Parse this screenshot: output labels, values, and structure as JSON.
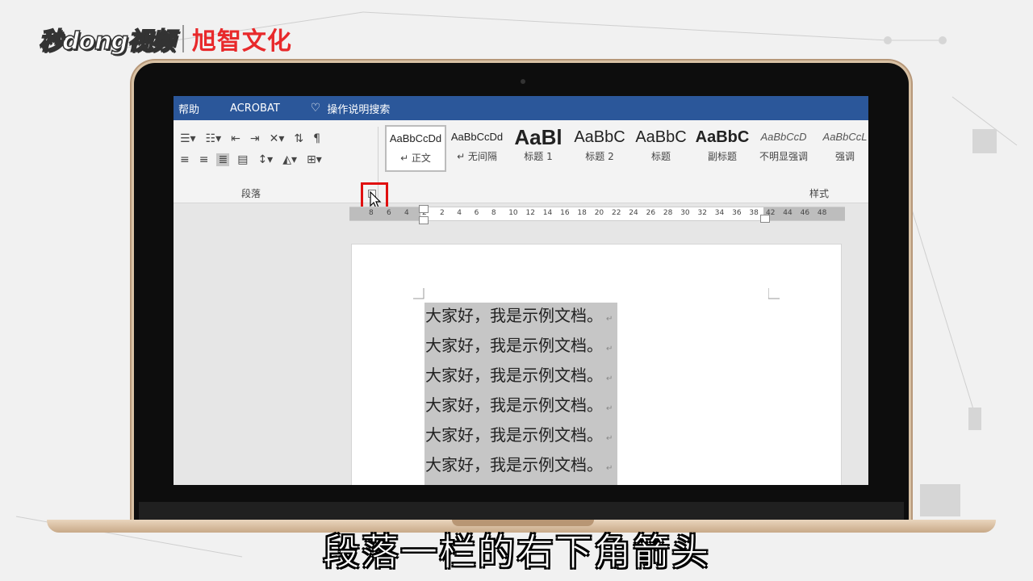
{
  "brand": {
    "left_logo": "秒dong视频",
    "right_logo": "旭智文化"
  },
  "word": {
    "tabs": [
      "帮助",
      "ACROBAT"
    ],
    "tell_me": "操作说明搜索",
    "groups": {
      "paragraph": "段落",
      "styles": "样式"
    },
    "styles": [
      {
        "preview": "AaBbCcDd",
        "name": "↵ 正文"
      },
      {
        "preview": "AaBbCcDd",
        "name": "↵ 无间隔"
      },
      {
        "preview": "AaBl",
        "name": "标题 1"
      },
      {
        "preview": "AaBbC",
        "name": "标题 2"
      },
      {
        "preview": "AaBbC",
        "name": "标题"
      },
      {
        "preview": "AaBbC",
        "name": "副标题"
      },
      {
        "preview": "AaBbCcD",
        "name": "不明显强调"
      },
      {
        "preview": "AaBbCcL",
        "name": "强调"
      }
    ],
    "ruler_numbers": [
      "8",
      "6",
      "4",
      "2",
      "2",
      "4",
      "6",
      "8",
      "10",
      "12",
      "14",
      "16",
      "18",
      "20",
      "22",
      "24",
      "26",
      "28",
      "30",
      "32",
      "34",
      "36",
      "38",
      "42",
      "44",
      "46",
      "48"
    ],
    "document_lines": [
      "大家好，我是示例文档。",
      "大家好，我是示例文档。",
      "大家好，我是示例文档。",
      "大家好，我是示例文档。",
      "大家好，我是示例文档。",
      "大家好，我是示例文档。"
    ],
    "paragraph_mark": "↵"
  },
  "subtitle": "段落一栏的右下角箭头",
  "colors": {
    "ribbon_tab": "#2b579a",
    "highlight_box": "#e01010",
    "selection": "#c6c6c6"
  }
}
